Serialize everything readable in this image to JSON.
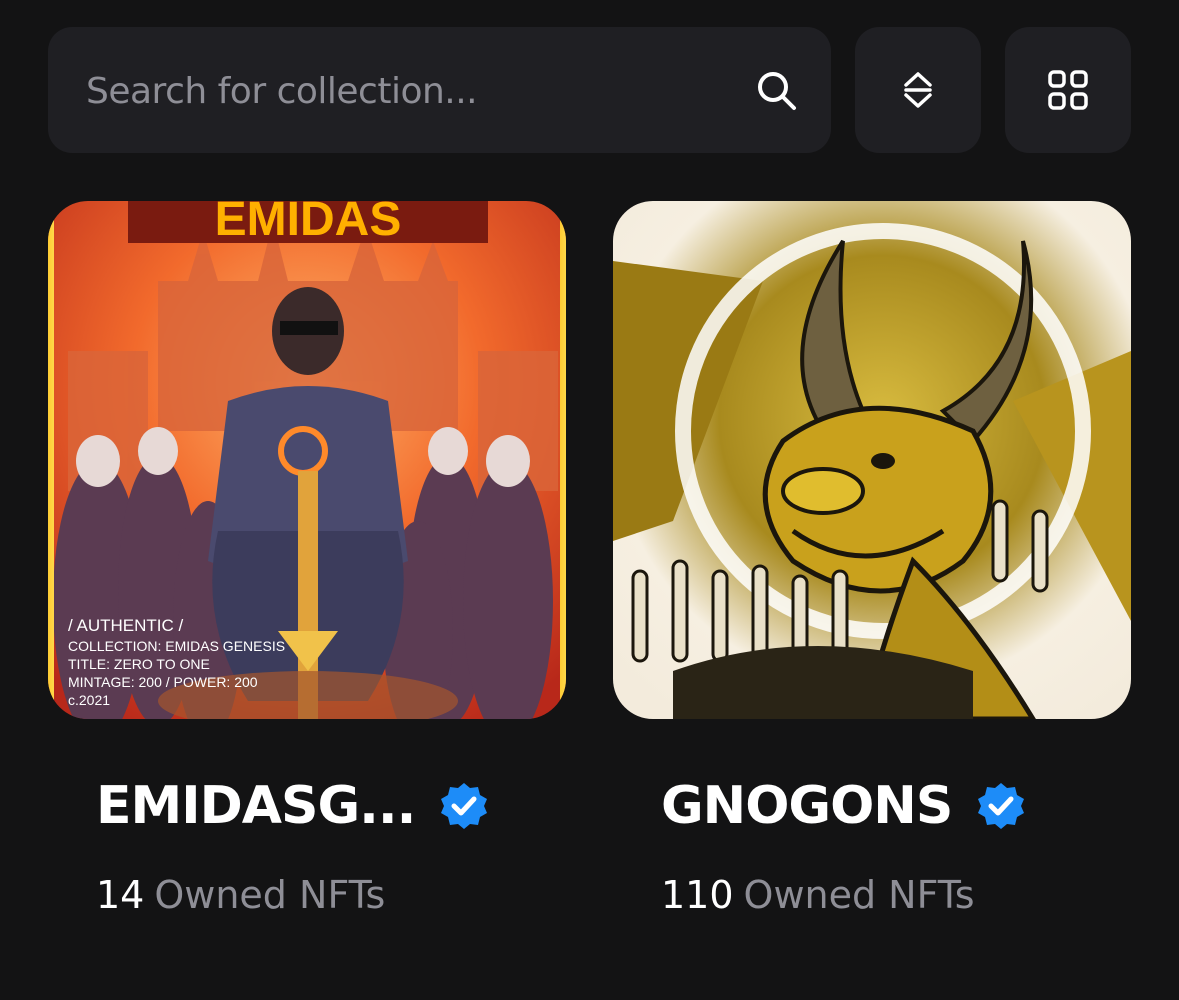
{
  "search": {
    "placeholder": "Search for collection..."
  },
  "toolbar": {
    "sort_icon": "sort-updown-icon",
    "view_icon": "grid-view-icon"
  },
  "collections": [
    {
      "name": "EMIDASG...",
      "verified": true,
      "owned_count": "14",
      "owned_label": "Owned NFTs",
      "image": {
        "banner": "EMIDAS",
        "lines": [
          "/ AUTHENTIC /",
          "COLLECTION: EMIDAS GENESIS",
          "TITLE: ZERO TO ONE",
          "MINTAGE: 200 / POWER: 200",
          "c.2021"
        ]
      }
    },
    {
      "name": "GNOGONS",
      "verified": true,
      "owned_count": "110",
      "owned_label": "Owned NFTs"
    }
  ],
  "colors": {
    "background": "#131314",
    "surface": "#1f1f23",
    "verified_blue": "#1d8cf8",
    "muted_text": "#8e8e96"
  }
}
